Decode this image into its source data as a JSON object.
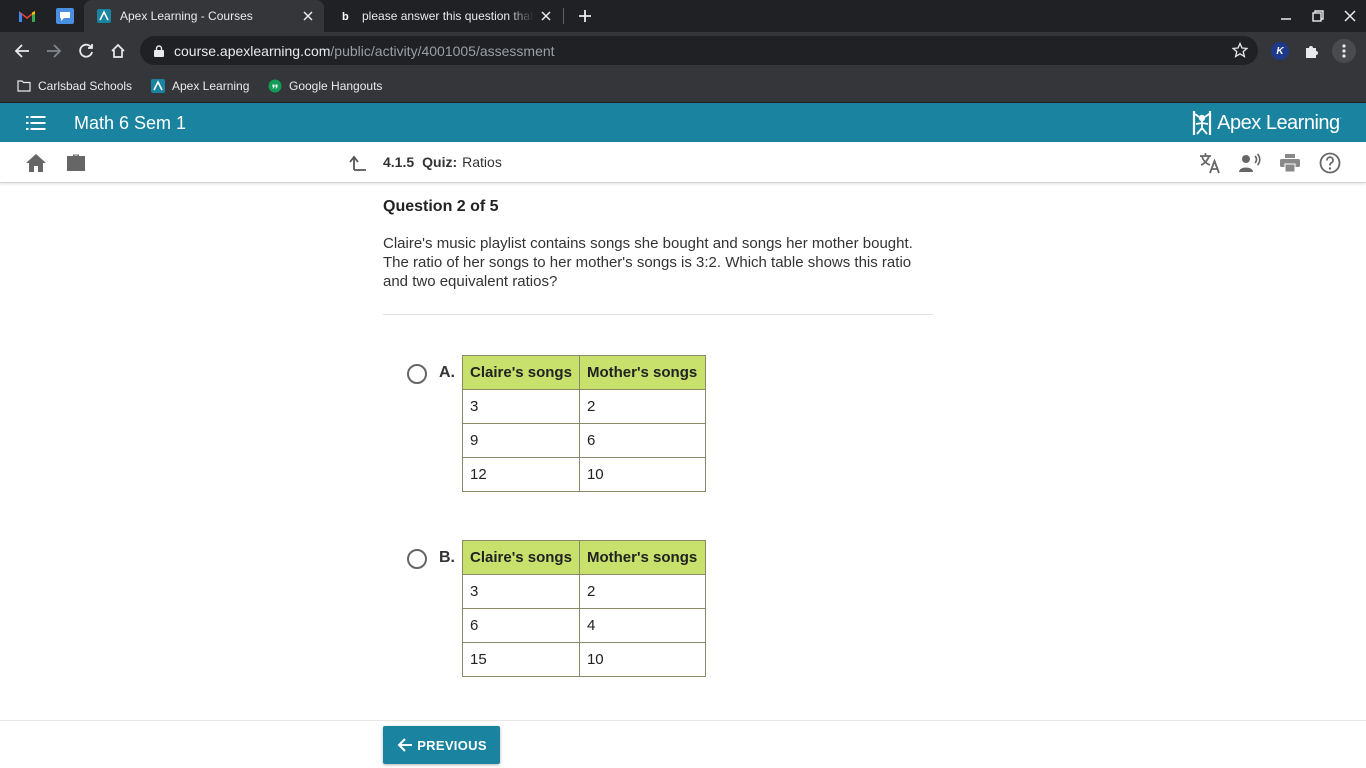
{
  "browser": {
    "tabs": [
      {
        "title": "Apex Learning - Courses",
        "active": true
      },
      {
        "title": "please answer this question that",
        "active": false
      }
    ],
    "url_host": "course.apexlearning.com",
    "url_path": "/public/activity/4001005/assessment",
    "extension_badge": "K",
    "bookmarks": [
      {
        "label": "Carlsbad Schools",
        "icon": "folder-icon"
      },
      {
        "label": "Apex Learning",
        "icon": "apex-favicon"
      },
      {
        "label": "Google Hangouts",
        "icon": "hangouts-icon"
      }
    ]
  },
  "app": {
    "course_title": "Math 6 Sem 1",
    "logo_text": "Apex Learning",
    "logo_tm": "·",
    "brand_color": "#1a839f",
    "breadcrumb": {
      "number": "4.1.5",
      "kind": "Quiz:",
      "name": "Ratios"
    }
  },
  "question": {
    "heading": "Question 2 of 5",
    "text": "Claire's music playlist contains songs she bought and songs her mother bought. The ratio of her songs to her mother's songs is 3:2. Which table shows this ratio and two equivalent ratios?"
  },
  "options": [
    {
      "label": "A.",
      "headers": [
        "Claire's songs",
        "Mother's songs"
      ],
      "rows": [
        [
          "3",
          "2"
        ],
        [
          "9",
          "6"
        ],
        [
          "12",
          "10"
        ]
      ]
    },
    {
      "label": "B.",
      "headers": [
        "Claire's songs",
        "Mother's songs"
      ],
      "rows": [
        [
          "3",
          "2"
        ],
        [
          "6",
          "4"
        ],
        [
          "15",
          "10"
        ]
      ]
    }
  ],
  "footer": {
    "previous_label": "PREVIOUS"
  }
}
